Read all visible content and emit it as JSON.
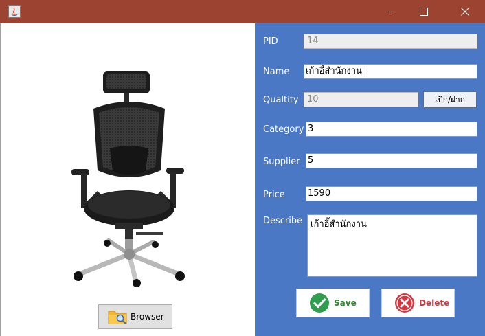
{
  "window": {
    "minimize_icon": "minimize-icon",
    "maximize_icon": "maximize-icon",
    "close_icon": "close-icon",
    "app_icon": "java-icon",
    "titlebar_color": "#9c4431"
  },
  "left": {
    "image": "office-chair-image",
    "browse_label": "Browser",
    "browse_icon": "folder-search-icon"
  },
  "form": {
    "panel_color": "#4a78c4",
    "pid_label": "PID",
    "pid_value": "14",
    "name_label": "Name",
    "name_value": "เก้าอี้สำนักงาน",
    "quantity_label": "Qualtity",
    "quantity_value": "10",
    "withdraw_label": "เบิก/ฝาก",
    "category_label": "Category",
    "category_value": "3",
    "supplier_label": "Supplier",
    "supplier_value": "5",
    "price_label": "Price",
    "price_value": "1590",
    "describe_label": "Describe",
    "describe_value": "เก้าอี้สำนักงาน"
  },
  "actions": {
    "save_label": "Save",
    "save_icon": "check-circle-icon",
    "save_color": "#2f9e4f",
    "delete_label": "Delete",
    "delete_icon": "x-circle-icon",
    "delete_color": "#d9363e"
  }
}
